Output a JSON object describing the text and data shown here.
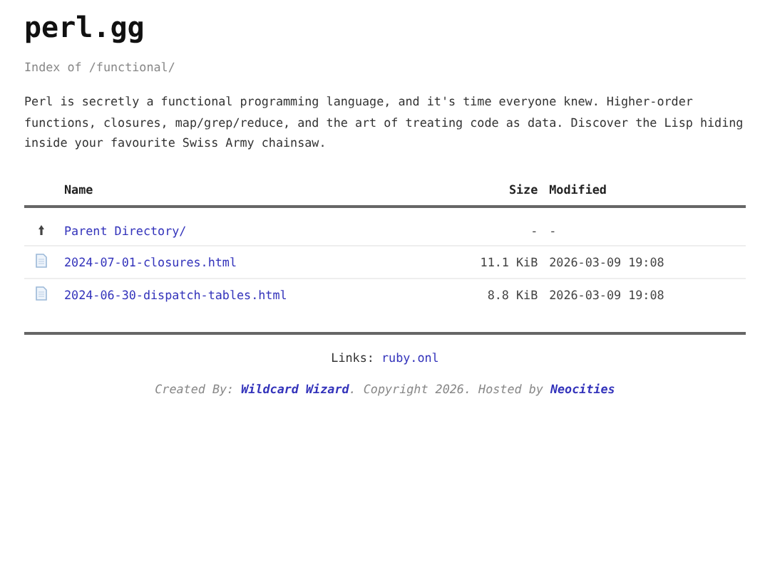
{
  "site_title": "perl.gg",
  "index_path": "Index of /functional/",
  "intro": "Perl is secretly a functional programming language, and it's time everyone knew. Higher-order functions, closures, map/grep/reduce, and the art of treating code as data. Discover the Lisp hiding inside your favourite Swiss Army chainsaw.",
  "table": {
    "columns": [
      "Name",
      "Size",
      "Modified"
    ],
    "rows": [
      {
        "kind": "parent",
        "name": "Parent Directory/",
        "size": "-",
        "modified": "-"
      },
      {
        "kind": "file",
        "name": "2024-07-01-closures.html",
        "size": "11.1 KiB",
        "modified": "2026-03-09 19:08"
      },
      {
        "kind": "file",
        "name": "2024-06-30-dispatch-tables.html",
        "size": "8.8 KiB",
        "modified": "2026-03-09 19:08"
      }
    ]
  },
  "links_line": [
    {
      "kind": "text",
      "text": "Links:"
    },
    {
      "kind": "link",
      "text": "ruby.onl"
    }
  ],
  "credit_line": [
    {
      "kind": "text",
      "text": "Created By:"
    },
    {
      "kind": "link",
      "text": "Wildcard Wizard"
    },
    {
      "kind": "text",
      "text": ". Copyright 2026. Hosted by"
    },
    {
      "kind": "link",
      "text": "Neocities"
    }
  ]
}
